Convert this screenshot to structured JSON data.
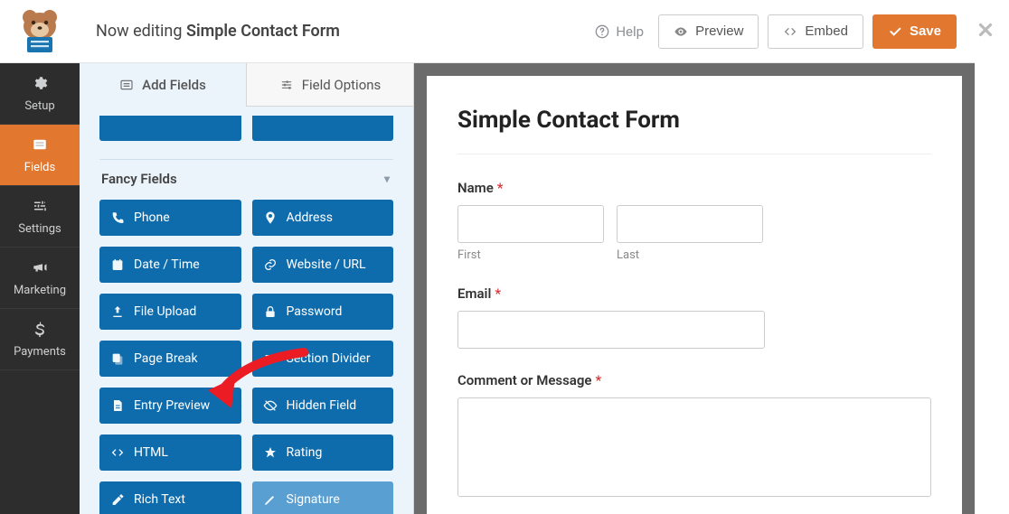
{
  "header": {
    "editing_prefix": "Now editing",
    "form_name": "Simple Contact Form",
    "help": "Help",
    "preview": "Preview",
    "embed": "Embed",
    "save": "Save"
  },
  "nav": {
    "setup": "Setup",
    "fields": "Fields",
    "settings": "Settings",
    "marketing": "Marketing",
    "payments": "Payments"
  },
  "panel": {
    "tab_add": "Add Fields",
    "tab_options": "Field Options",
    "group_title": "Fancy Fields",
    "fields": [
      {
        "id": "phone",
        "label": "Phone",
        "icon": "phone"
      },
      {
        "id": "address",
        "label": "Address",
        "icon": "pin"
      },
      {
        "id": "datetime",
        "label": "Date / Time",
        "icon": "calendar"
      },
      {
        "id": "url",
        "label": "Website / URL",
        "icon": "link"
      },
      {
        "id": "file",
        "label": "File Upload",
        "icon": "upload"
      },
      {
        "id": "password",
        "label": "Password",
        "icon": "lock"
      },
      {
        "id": "pagebreak",
        "label": "Page Break",
        "icon": "copy"
      },
      {
        "id": "section",
        "label": "Section Divider",
        "icon": "bars"
      },
      {
        "id": "entrypreview",
        "label": "Entry Preview",
        "icon": "doc"
      },
      {
        "id": "hidden",
        "label": "Hidden Field",
        "icon": "eye-off"
      },
      {
        "id": "html",
        "label": "HTML",
        "icon": "code"
      },
      {
        "id": "rating",
        "label": "Rating",
        "icon": "star"
      },
      {
        "id": "richtext",
        "label": "Rich Text",
        "icon": "edit"
      },
      {
        "id": "signature",
        "label": "Signature",
        "icon": "pencil",
        "dim": true
      }
    ]
  },
  "preview": {
    "title": "Simple Contact Form",
    "name_label": "Name",
    "first": "First",
    "last": "Last",
    "email_label": "Email",
    "comment_label": "Comment or Message"
  }
}
